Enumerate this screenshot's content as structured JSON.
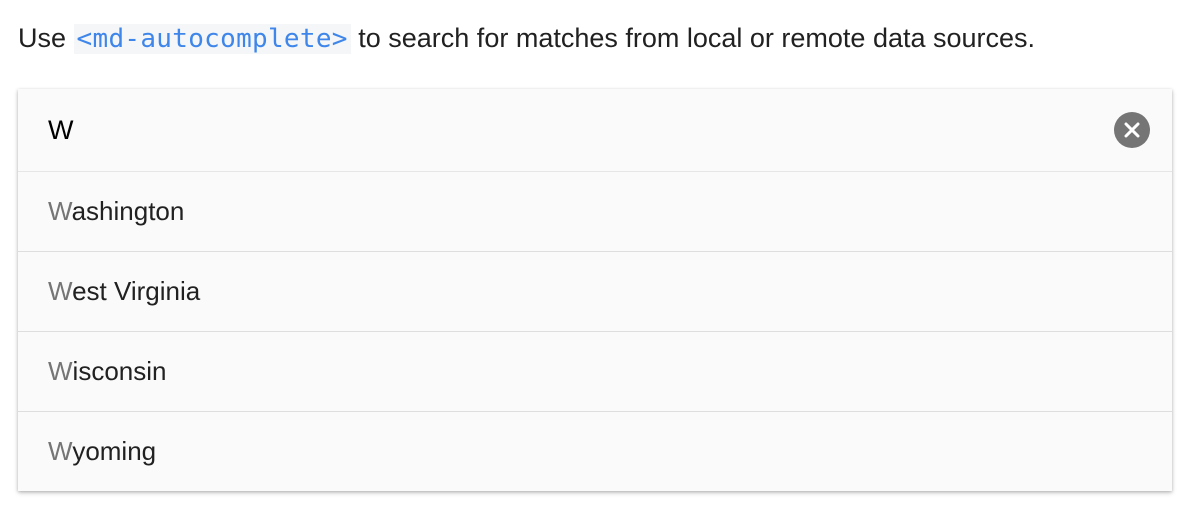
{
  "intro": {
    "prefix": "Use ",
    "code": "<md-autocomplete>",
    "suffix": " to search for matches from local or remote data sources."
  },
  "search": {
    "value": "W",
    "placeholder": ""
  },
  "suggestions": [
    {
      "match": "W",
      "rest": "ashington"
    },
    {
      "match": "W",
      "rest": "est Virginia"
    },
    {
      "match": "W",
      "rest": "isconsin"
    },
    {
      "match": "W",
      "rest": "yoming"
    }
  ],
  "icons": {
    "clear": "close-circle-icon"
  },
  "colors": {
    "code_text": "#3f86ea",
    "code_bg": "#f4f6f8",
    "clear_icon_bg": "#757575",
    "match_highlight": "#757575"
  }
}
